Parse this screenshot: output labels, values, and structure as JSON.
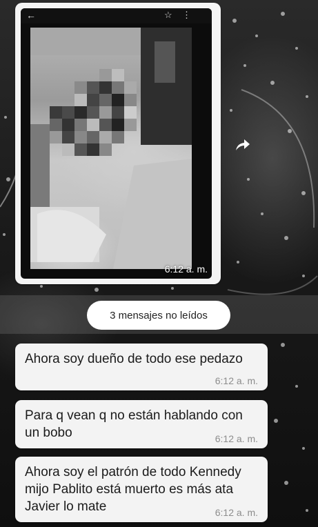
{
  "image_message": {
    "time": "6:12 a. m.",
    "viewer_icons": [
      "back-arrow-icon",
      "star-icon",
      "more-menu-icon"
    ],
    "content": "blurred-photo"
  },
  "forward_icon": "forward-arrow-icon",
  "unread_banner": {
    "label": "3 mensajes no leídos"
  },
  "messages": [
    {
      "text": "Ahora soy dueño de todo ese pedazo",
      "time": "6:12 a. m."
    },
    {
      "text": "Para q vean q no están hablando con un bobo",
      "time": "6:12 a. m."
    },
    {
      "text": "Ahora soy el patrón de todo Kennedy mijo Pablito está muerto es más ata Javier lo mate",
      "time": "6:12 a. m."
    }
  ]
}
